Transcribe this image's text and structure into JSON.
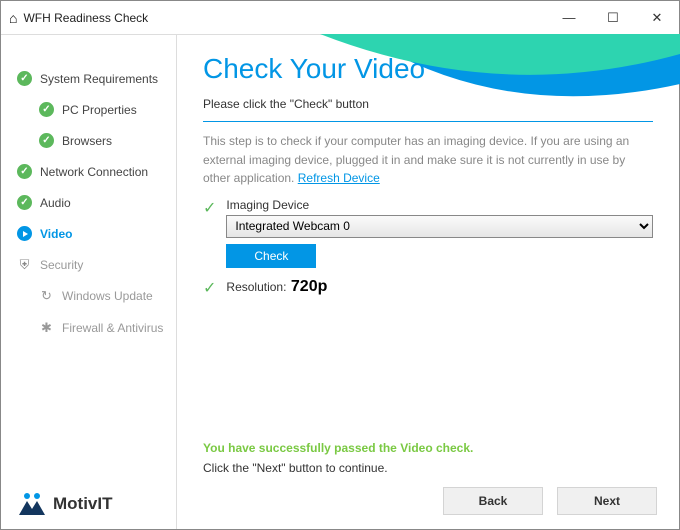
{
  "window": {
    "title": "WFH Readiness Check"
  },
  "sidebar": {
    "items": [
      {
        "label": "System Requirements"
      },
      {
        "label": "PC Properties"
      },
      {
        "label": "Browsers"
      },
      {
        "label": "Network Connection"
      },
      {
        "label": "Audio"
      },
      {
        "label": "Video"
      },
      {
        "label": "Security"
      },
      {
        "label": "Windows Update"
      },
      {
        "label": "Firewall & Antivirus"
      }
    ]
  },
  "logo": {
    "text": "MotivIT"
  },
  "main": {
    "heading": "Check Your Video",
    "subtitle": "Please click the \"Check\" button",
    "description": "This step is to check if your computer has an imaging device. If you are using an external imaging device, plugged it in and make sure it is not currently in use by other application.  ",
    "refresh_link": "Refresh Device",
    "imaging_label": "Imaging Device",
    "imaging_value": "Integrated Webcam 0",
    "check_btn": "Check",
    "resolution_label": "Resolution:",
    "resolution_value": "720p",
    "success_msg": "You have successfully passed the Video check.",
    "next_msg": "Click the \"Next\" button to continue."
  },
  "buttons": {
    "back": "Back",
    "next": "Next"
  }
}
